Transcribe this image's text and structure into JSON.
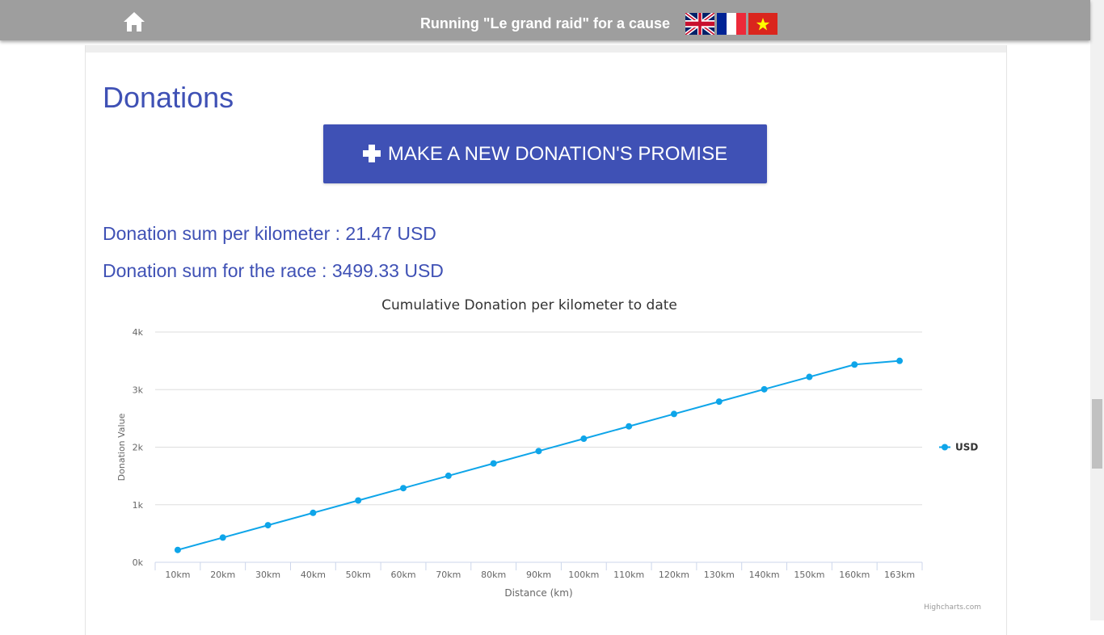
{
  "header": {
    "title": "Running \"Le grand raid\" for a cause",
    "languages": [
      "English",
      "Français",
      "Tiếng Việt"
    ]
  },
  "page": {
    "heading": "Donations",
    "donate_button": "MAKE A NEW DONATION'S PROMISE",
    "per_km_label": "Donation sum per kilometer : ",
    "per_km_value": "21.47 USD",
    "race_label": "Donation sum for the race : ",
    "race_value": "3499.33 USD"
  },
  "colors": {
    "topbar": "#9e9e9e",
    "accent": "#3f51b5",
    "series": "#0ea5e9"
  },
  "chart_data": {
    "type": "line",
    "title": "Cumulative Donation per kilometer to date",
    "xlabel": "Distance (km)",
    "ylabel": "Donation Value",
    "categories": [
      "10km",
      "20km",
      "30km",
      "40km",
      "50km",
      "60km",
      "70km",
      "80km",
      "90km",
      "100km",
      "110km",
      "120km",
      "130km",
      "140km",
      "150km",
      "160km",
      "163km"
    ],
    "series": [
      {
        "name": "USD",
        "values": [
          214.7,
          429.4,
          644.1,
          858.8,
          1073.5,
          1288.2,
          1502.9,
          1717.6,
          1932.3,
          2147.0,
          2361.7,
          2576.4,
          2791.1,
          3005.8,
          3220.5,
          3435.2,
          3499.33
        ]
      }
    ],
    "ylim": [
      0,
      4000
    ],
    "yticks": [
      "0k",
      "1k",
      "2k",
      "3k",
      "4k"
    ],
    "grid": true,
    "legend": "right",
    "credits": "Highcharts.com"
  }
}
